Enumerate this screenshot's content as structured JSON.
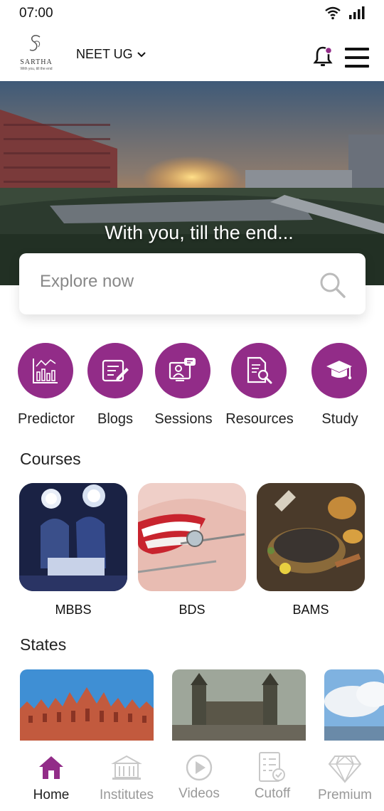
{
  "status": {
    "time": "07:00"
  },
  "header": {
    "brand": "SARTHA",
    "tagline": "With you, till the end",
    "exam": "NEET UG"
  },
  "hero": {
    "caption": "With you, till the end..."
  },
  "search": {
    "placeholder": "Explore now"
  },
  "quick_links": [
    {
      "label": "Predictor",
      "icon": "chart-icon"
    },
    {
      "label": "Blogs",
      "icon": "blog-edit-icon"
    },
    {
      "label": "Sessions",
      "icon": "video-session-icon"
    },
    {
      "label": "Resources",
      "icon": "document-search-icon"
    },
    {
      "label": "Study",
      "icon": "graduation-cap-icon"
    }
  ],
  "courses": {
    "title": "Courses",
    "items": [
      {
        "label": "MBBS"
      },
      {
        "label": "BDS"
      },
      {
        "label": "BAMS"
      }
    ]
  },
  "states": {
    "title": "States"
  },
  "bottom_nav": [
    {
      "label": "Home",
      "active": true
    },
    {
      "label": "Institutes"
    },
    {
      "label": "Videos"
    },
    {
      "label": "Cutoff"
    },
    {
      "label": "Premium"
    }
  ],
  "colors": {
    "accent": "#922c88",
    "inactive": "#999999"
  }
}
